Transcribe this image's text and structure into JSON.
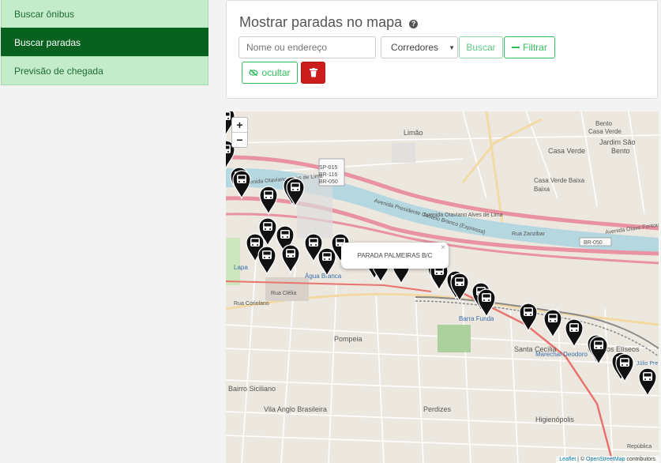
{
  "sidebar": {
    "items": [
      {
        "label": "Buscar ônibus"
      },
      {
        "label": "Buscar paradas"
      },
      {
        "label": "Previsão de chegada"
      }
    ]
  },
  "panel": {
    "title": "Mostrar paradas no mapa",
    "search_placeholder": "Nome ou endereço",
    "select_value": "Corredores",
    "buscar_label": "Buscar",
    "filtrar_label": "Filtrar",
    "ocultar_label": "ocultar"
  },
  "map": {
    "zoom_in": "+",
    "zoom_out": "−",
    "popup_text": "PARADA PALMEIRAS B/C",
    "popup_close": "×",
    "attribution": {
      "leaflet": "Leaflet",
      "sep": " | © ",
      "osm": "OpenStreetMap",
      "suffix": " contributors"
    },
    "labels": {
      "limao": "Limão",
      "casa_verde": "Casa Verde",
      "casa_verde_baixa": "Casa Verde Baixa",
      "casa_verde_baixa_2": "Baixa",
      "jardim_sao_bento": "Jardim São",
      "jardim_sao_bento_2": "Bento",
      "casa_verde_2": "Casa Verde",
      "casa_verde_bento": "Bento",
      "sp015": "SP-015",
      "br116": "BR-116",
      "br050": "BR-050",
      "br050b": "BR-050",
      "av_marginal": "Avenida Otaviano Alves de Lima",
      "av_presidente": "Avenida Presidente Castelo Branco (Expressa)",
      "av_otaviano2": "Avenida Otaviano Alves de Lima",
      "rua_zanzibar": "Rua Zanzibar",
      "av_olavo": "Avenida Olavo Fontoura",
      "barra_funda": "Barra Funda",
      "pompeia": "Pompeia",
      "bairro_siciliano": "Bairro Siciliano",
      "vila_anglo": "Vila Anglo Brasileira",
      "perdizes": "Perdizes",
      "santa_cecilia": "Santa Cecília",
      "marechal": "Marechal Deodoro",
      "campos_eliseos": "Campos Elíseos",
      "higienopolis": "Higienópolis",
      "lapa": "Lapa",
      "agua_branca": "Água Branca",
      "republica": "República",
      "rua_clelia": "Rua Clélia",
      "rua_coriolano": "Rua Coriolano",
      "julio_prestes": "Júlio Pre"
    }
  },
  "colors": {
    "sidebar_bg": "#c4ecca",
    "sidebar_active": "#07621f",
    "accent_green": "#2ebd5c",
    "danger": "#cc1d1d"
  }
}
